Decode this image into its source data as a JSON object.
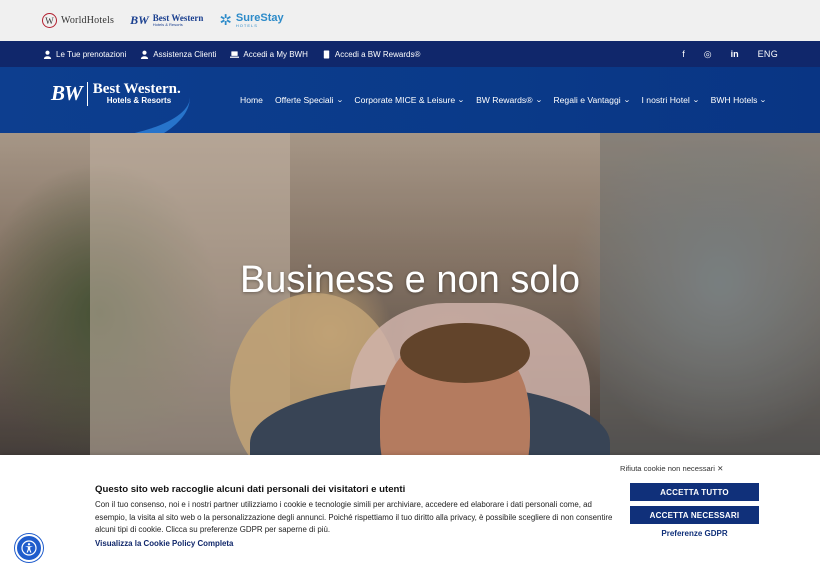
{
  "brands": {
    "worldhotels": {
      "mark": "W",
      "label": "WorldHotels"
    },
    "bestwestern": {
      "mark": "BW",
      "name": "Best Western",
      "sub": "Hotels & Resorts"
    },
    "surestay": {
      "mark": "✲",
      "name": "SureStay",
      "sub": "HOTELS"
    }
  },
  "topbar": {
    "links": [
      {
        "label": "Le Tue prenotazioni",
        "icon": "person-icon"
      },
      {
        "label": "Assistenza Clienti",
        "icon": "person-icon"
      },
      {
        "label": "Accedi a My BWH",
        "icon": "laptop-icon"
      },
      {
        "label": "Accedi a BW Rewards®",
        "icon": "card-icon"
      }
    ],
    "social": {
      "facebook": "f",
      "instagram": "◎",
      "linkedin": "in"
    },
    "language": "ENG"
  },
  "header": {
    "logo": {
      "mark": "BW",
      "name": "Best Western.",
      "sub": "Hotels & Resorts"
    },
    "nav": [
      {
        "label": "Home",
        "dropdown": false
      },
      {
        "label": "Offerte Speciali",
        "dropdown": true
      },
      {
        "label": "Corporate MICE & Leisure",
        "dropdown": true
      },
      {
        "label": "BW Rewards®",
        "dropdown": true
      },
      {
        "label": "Regali e Vantaggi",
        "dropdown": true
      },
      {
        "label": "I nostri Hotel",
        "dropdown": true
      },
      {
        "label": "BWH Hotels",
        "dropdown": true
      }
    ],
    "chevron": "⌄"
  },
  "hero": {
    "title": "Business e non solo"
  },
  "cookie": {
    "reject": "Rifiuta cookie non necessari ✕",
    "title": "Questo sito web raccoglie alcuni dati personali dei visitatori e utenti",
    "text": "Con il tuo consenso, noi e i nostri partner utilizziamo i cookie e tecnologie simili per archiviare, accedere ed elaborare i dati personali come, ad esempio, la visita al sito web o la personalizzazione degli annunci. Poiché rispettiamo il tuo diritto alla privacy, è possibile scegliere di non consentire alcuni tipi di cookie. Clicca su preferenze GDPR per saperne di più.",
    "policy_link": "Visualizza la Cookie Policy Completa",
    "accept_all": "ACCETTA TUTTO",
    "accept_necessary": "ACCETTA NECESSARI",
    "preferences": "Preferenze GDPR"
  },
  "colors": {
    "navy": "#10276b",
    "header_blue": "#0d3e8f",
    "button": "#10307a",
    "accessibility": "#1f5ccc"
  }
}
